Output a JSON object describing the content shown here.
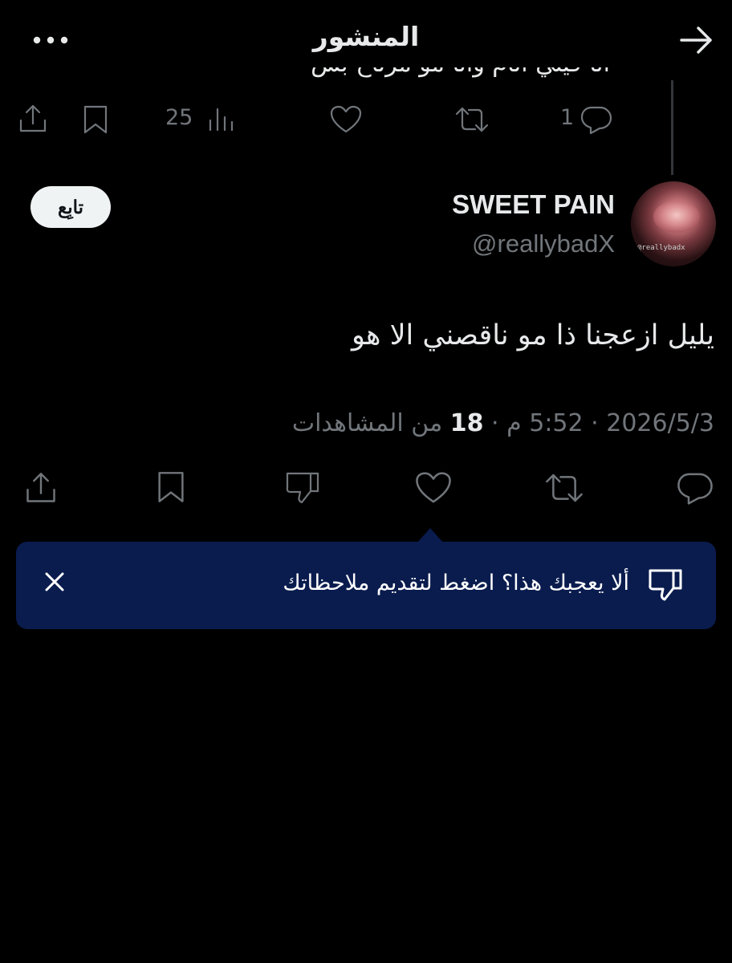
{
  "header": {
    "title": "المنشور",
    "back_icon": "arrow-right-icon",
    "more_icon": "more-dots-icon"
  },
  "previous_post": {
    "cut_text": "أنا فيني أنام وأنا مو مرتاح بس",
    "replies": "1",
    "views": "25"
  },
  "post": {
    "author_name": "SWEET PAIN",
    "handle": "@reallybadX",
    "avatar_watermark": "@reallybadx",
    "follow_label": "تابِع",
    "text": "يليل ازعجنا ذا مو ناقصني الا هو",
    "date": "2026/5/3",
    "time": "5:52 م",
    "separator": "·",
    "views_count": "18",
    "views_label": "من المشاهدات"
  },
  "toast": {
    "text": "ألا يعجبك هذا؟ اضغط لتقديم ملاحظاتك",
    "background": "#0a1c4e"
  },
  "colors": {
    "background": "#000000",
    "primary_text": "#e7e9ea",
    "secondary_text": "#71767b"
  }
}
